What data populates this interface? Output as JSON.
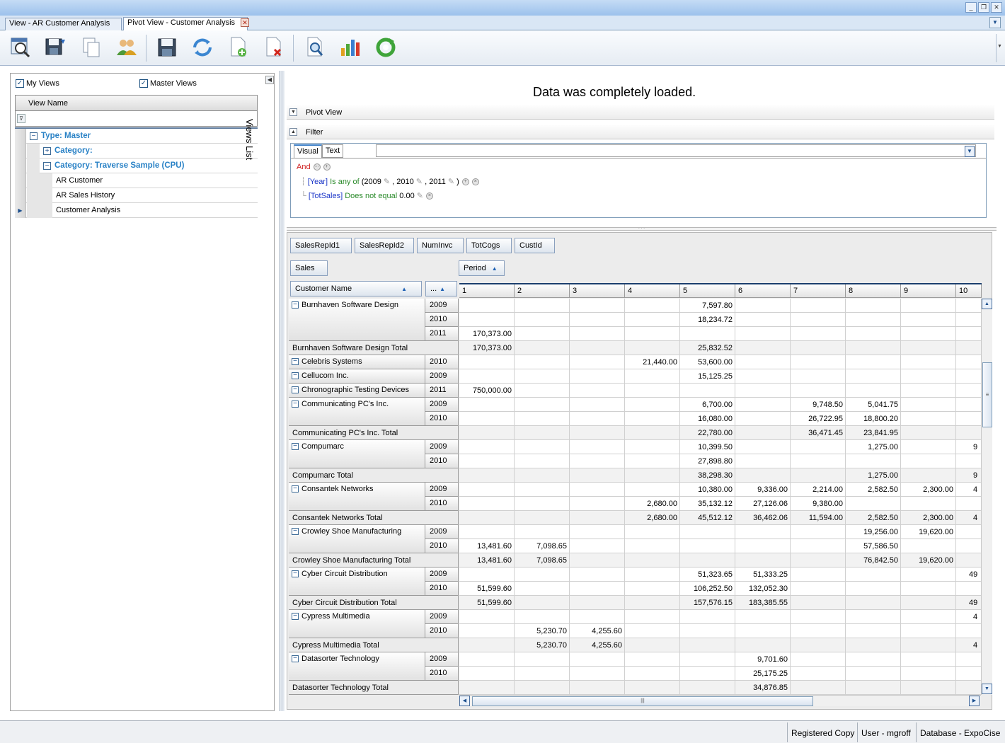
{
  "window": {
    "controls": [
      "_",
      "❐",
      "✕"
    ]
  },
  "tabs": [
    {
      "label": "View - AR Customer Analysis",
      "active": false
    },
    {
      "label": "Pivot View - Customer Analysis",
      "active": true,
      "close": "✕"
    }
  ],
  "toolbar": {
    "buttons": [
      "search-view-icon",
      "save-as-icon",
      "copy-icon",
      "users-icon",
      "save-icon",
      "refresh-icon",
      "new-document-icon",
      "delete-document-icon",
      "print-preview-icon",
      "chart-icon",
      "reload-icon"
    ]
  },
  "views_panel": {
    "my_views_label": "My Views",
    "master_views_label": "Master Views",
    "column_header": "View Name",
    "vertical_title": "Views List",
    "tree": {
      "type_group": "Type: Master",
      "category_empty": "Category:",
      "category_group": "Category: Traverse Sample (CPU)",
      "items": [
        "AR Customer",
        "AR Sales History",
        "Customer Analysis"
      ]
    }
  },
  "main": {
    "status": "Data was completely loaded.",
    "pivot_section_label": "Pivot View",
    "filter_section_label": "Filter",
    "filter": {
      "tabs": [
        "Visual",
        "Text"
      ],
      "root_op": "And",
      "cond1": {
        "field": "[Year]",
        "op": "Is any of",
        "open": "(",
        "values": [
          "2009",
          "2010",
          "2011"
        ],
        "sep": ",",
        "close": ")"
      },
      "cond2": {
        "field": "[TotSales]",
        "op": "Does not equal",
        "value": "0.00"
      }
    }
  },
  "pivot": {
    "filter_fields": [
      "SalesRepId1",
      "SalesRepId2",
      "NumInvc",
      "TotCogs",
      "CustId"
    ],
    "data_field": "Sales",
    "column_field": "Period",
    "row_fields": [
      "Customer Name",
      "..."
    ],
    "columns": [
      "1",
      "2",
      "3",
      "4",
      "5",
      "6",
      "7",
      "8",
      "9",
      "10"
    ],
    "rows": [
      {
        "kind": "year",
        "customer": "Burnhaven Software Design",
        "year": "2009",
        "values": [
          "",
          "",
          "",
          "",
          "7,597.80",
          "",
          "",
          "",
          "",
          ""
        ]
      },
      {
        "kind": "year",
        "customer": "",
        "year": "2010",
        "values": [
          "",
          "",
          "",
          "",
          "18,234.72",
          "",
          "",
          "",
          "",
          ""
        ]
      },
      {
        "kind": "year",
        "customer": "",
        "year": "2011",
        "values": [
          "170,373.00",
          "",
          "",
          "",
          "",
          "",
          "",
          "",
          "",
          ""
        ]
      },
      {
        "kind": "total",
        "customer": "Burnhaven Software Design Total",
        "values": [
          "170,373.00",
          "",
          "",
          "",
          "25,832.52",
          "",
          "",
          "",
          "",
          ""
        ]
      },
      {
        "kind": "single",
        "customer": "Celebris Systems",
        "year": "2010",
        "values": [
          "",
          "",
          "",
          "21,440.00",
          "53,600.00",
          "",
          "",
          "",
          "",
          ""
        ]
      },
      {
        "kind": "single",
        "customer": "Cellucom Inc.",
        "year": "2009",
        "values": [
          "",
          "",
          "",
          "",
          "15,125.25",
          "",
          "",
          "",
          "",
          ""
        ]
      },
      {
        "kind": "single",
        "customer": "Chronographic Testing Devices",
        "year": "2011",
        "values": [
          "750,000.00",
          "",
          "",
          "",
          "",
          "",
          "",
          "",
          "",
          ""
        ]
      },
      {
        "kind": "year",
        "customer": "Communicating PC's Inc.",
        "year": "2009",
        "values": [
          "",
          "",
          "",
          "",
          "6,700.00",
          "",
          "9,748.50",
          "5,041.75",
          "",
          ""
        ]
      },
      {
        "kind": "year",
        "customer": "",
        "year": "2010",
        "values": [
          "",
          "",
          "",
          "",
          "16,080.00",
          "",
          "26,722.95",
          "18,800.20",
          "",
          ""
        ]
      },
      {
        "kind": "total",
        "customer": "Communicating PC's Inc. Total",
        "values": [
          "",
          "",
          "",
          "",
          "22,780.00",
          "",
          "36,471.45",
          "23,841.95",
          "",
          ""
        ]
      },
      {
        "kind": "year",
        "customer": "Compumarc",
        "year": "2009",
        "values": [
          "",
          "",
          "",
          "",
          "10,399.50",
          "",
          "",
          "1,275.00",
          "",
          "9"
        ]
      },
      {
        "kind": "year",
        "customer": "",
        "year": "2010",
        "values": [
          "",
          "",
          "",
          "",
          "27,898.80",
          "",
          "",
          "",
          "",
          ""
        ]
      },
      {
        "kind": "total",
        "customer": "Compumarc Total",
        "values": [
          "",
          "",
          "",
          "",
          "38,298.30",
          "",
          "",
          "1,275.00",
          "",
          "9"
        ]
      },
      {
        "kind": "year",
        "customer": "Consantek Networks",
        "year": "2009",
        "values": [
          "",
          "",
          "",
          "",
          "10,380.00",
          "9,336.00",
          "2,214.00",
          "2,582.50",
          "2,300.00",
          "4"
        ]
      },
      {
        "kind": "year",
        "customer": "",
        "year": "2010",
        "values": [
          "",
          "",
          "",
          "2,680.00",
          "35,132.12",
          "27,126.06",
          "9,380.00",
          "",
          "",
          ""
        ]
      },
      {
        "kind": "total",
        "customer": "Consantek Networks Total",
        "values": [
          "",
          "",
          "",
          "2,680.00",
          "45,512.12",
          "36,462.06",
          "11,594.00",
          "2,582.50",
          "2,300.00",
          "4"
        ]
      },
      {
        "kind": "year",
        "customer": "Crowley Shoe Manufacturing",
        "year": "2009",
        "values": [
          "",
          "",
          "",
          "",
          "",
          "",
          "",
          "19,256.00",
          "19,620.00",
          ""
        ]
      },
      {
        "kind": "year",
        "customer": "",
        "year": "2010",
        "values": [
          "13,481.60",
          "7,098.65",
          "",
          "",
          "",
          "",
          "",
          "57,586.50",
          "",
          ""
        ]
      },
      {
        "kind": "total",
        "customer": "Crowley Shoe Manufacturing Total",
        "values": [
          "13,481.60",
          "7,098.65",
          "",
          "",
          "",
          "",
          "",
          "76,842.50",
          "19,620.00",
          ""
        ]
      },
      {
        "kind": "year",
        "customer": "Cyber Circuit Distribution",
        "year": "2009",
        "values": [
          "",
          "",
          "",
          "",
          "51,323.65",
          "51,333.25",
          "",
          "",
          "",
          "49"
        ]
      },
      {
        "kind": "year",
        "customer": "",
        "year": "2010",
        "values": [
          "51,599.60",
          "",
          "",
          "",
          "106,252.50",
          "132,052.30",
          "",
          "",
          "",
          ""
        ]
      },
      {
        "kind": "total",
        "customer": "Cyber Circuit Distribution Total",
        "values": [
          "51,599.60",
          "",
          "",
          "",
          "157,576.15",
          "183,385.55",
          "",
          "",
          "",
          "49"
        ]
      },
      {
        "kind": "year",
        "customer": "Cypress Multimedia",
        "year": "2009",
        "values": [
          "",
          "",
          "",
          "",
          "",
          "",
          "",
          "",
          "",
          "4"
        ]
      },
      {
        "kind": "year",
        "customer": "",
        "year": "2010",
        "values": [
          "",
          "5,230.70",
          "4,255.60",
          "",
          "",
          "",
          "",
          "",
          "",
          ""
        ]
      },
      {
        "kind": "total",
        "customer": "Cypress Multimedia Total",
        "values": [
          "",
          "5,230.70",
          "4,255.60",
          "",
          "",
          "",
          "",
          "",
          "",
          "4"
        ]
      },
      {
        "kind": "year",
        "customer": "Datasorter Technology",
        "year": "2009",
        "values": [
          "",
          "",
          "",
          "",
          "",
          "9,701.60",
          "",
          "",
          "",
          ""
        ]
      },
      {
        "kind": "year",
        "customer": "",
        "year": "2010",
        "values": [
          "",
          "",
          "",
          "",
          "",
          "25,175.25",
          "",
          "",
          "",
          ""
        ]
      },
      {
        "kind": "total",
        "customer": "Datasorter Technology Total",
        "values": [
          "",
          "",
          "",
          "",
          "",
          "34,876.85",
          "",
          "",
          "",
          ""
        ]
      }
    ]
  },
  "statusbar": {
    "registration": "Registered Copy",
    "user": "User - mgroff",
    "database": "Database - ExpoCise"
  }
}
